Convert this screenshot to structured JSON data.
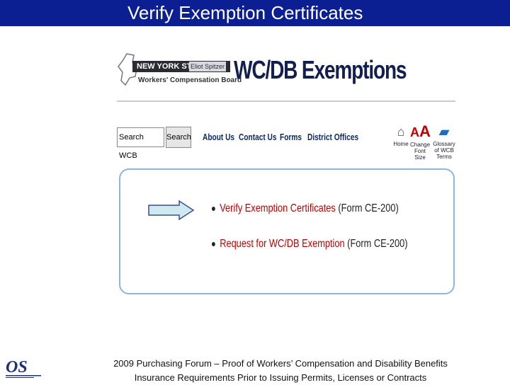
{
  "slide": {
    "title": "Verify Exemption Certificates"
  },
  "site": {
    "state_name": "NEW YORK STATE",
    "governor": "Eliot Spitzer",
    "board_name": "Workers' Compensation Board",
    "page_title": "WC/DB Exemptions"
  },
  "search": {
    "value": "Search WCB",
    "button_label": "Search"
  },
  "nav": {
    "items": [
      "About Us",
      "Contact Us",
      "Forms",
      "District Offices"
    ]
  },
  "utility": {
    "home_label": "Home",
    "font_label": "Change Font Size",
    "glossary_label": "Glossary of WCB Terms"
  },
  "panel": {
    "items": [
      {
        "link": "Verify Exemption Certificates",
        "suffix": " (Form CE-200)"
      },
      {
        "link": "Request for WC/DB Exemption",
        "suffix": " (Form CE-200)"
      }
    ]
  },
  "footer": {
    "line1": "2009 Purchasing Forum – Proof of Workers’ Compensation and Disability Benefits",
    "line2": "Insurance Requirements Prior to Issuing Permits, Licenses or Contracts",
    "logo_text": "OS"
  },
  "colors": {
    "title_bar": "#0b1e92",
    "link": "#c00000",
    "panel_border": "#8fb6dc",
    "arrow_fill": "#cfe9f0",
    "arrow_stroke": "#3a4f8f"
  }
}
